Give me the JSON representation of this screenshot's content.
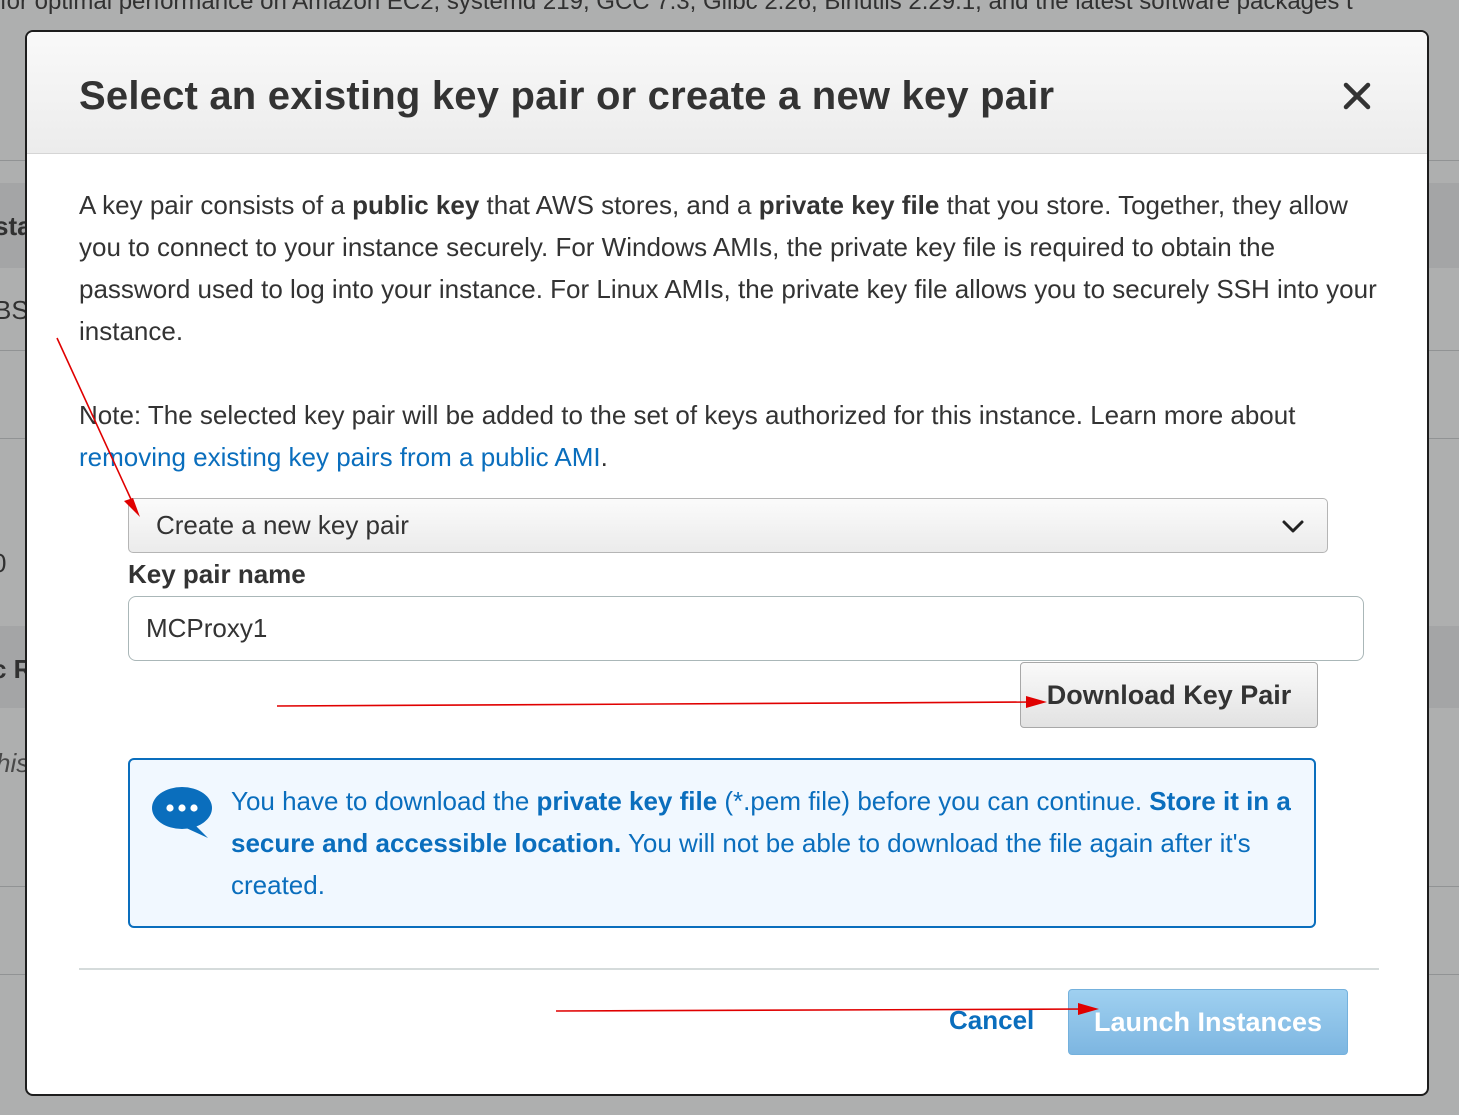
{
  "background": {
    "top_line": "for optimal performance on Amazon EC2, systemd 219, GCC 7.3, Glibc 2.26, Binutils 2.29.1, and the latest software packages t",
    "fragments": [
      "sta",
      "BS",
      "0",
      "c R",
      "his"
    ]
  },
  "modal": {
    "title": "Select an existing key pair or create a new key pair",
    "close_glyph": "×",
    "description": {
      "t1": "A key pair consists of a ",
      "b1": "public key",
      "t2": " that AWS stores, and a ",
      "b2": "private key file",
      "t3": " that you store. Together, they allow you to connect to your instance securely. For Windows AMIs, the private key file is required to obtain the password used to log into your instance. For Linux AMIs, the private key file allows you to securely SSH into your instance."
    },
    "note": {
      "text": "Note: The selected key pair will be added to the set of keys authorized for this instance. Learn more about ",
      "link": "removing existing key pairs from a public AMI",
      "end": "."
    },
    "key_pair_select": {
      "value": "Create a new key pair"
    },
    "key_pair_name": {
      "label": "Key pair name",
      "value": "MCProxy1"
    },
    "download_button": "Download Key Pair",
    "info": {
      "t1": "You have to download the ",
      "b1": "private key file",
      "t2": " (*.pem file) before you can continue. ",
      "b2": "Store it in a secure and accessible location.",
      "t3": " You will not be able to download the file again after it's created."
    },
    "cancel_label": "Cancel",
    "launch_label": "Launch Instances"
  },
  "colors": {
    "link": "#0a6ebd",
    "info_bg": "#f1f8ff",
    "launch_button": "#8cc4ea",
    "annotation_arrow": "#e00000"
  },
  "icons": {
    "close": "close-icon",
    "dropdown": "chevron-down-icon",
    "info": "speech-bubble-icon"
  }
}
